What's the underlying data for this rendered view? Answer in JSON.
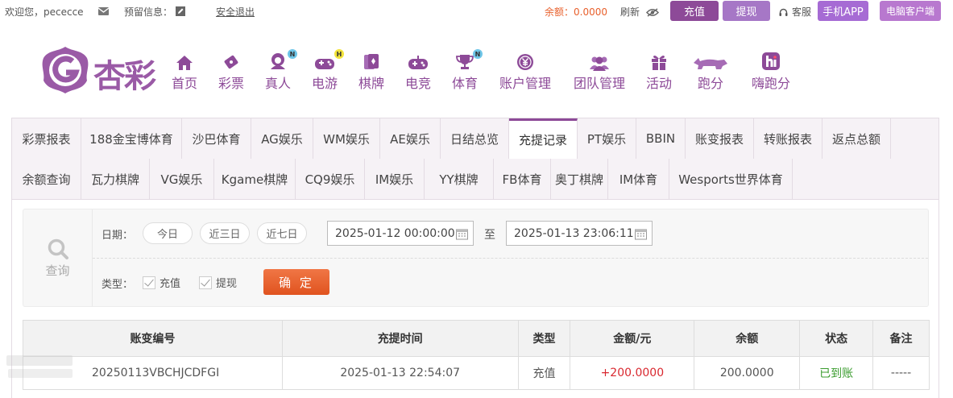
{
  "topbar": {
    "welcome": "欢迎您，pececce",
    "reserved_label": "预留信息：",
    "logout": "安全退出",
    "balance_label": "余额：",
    "balance_value": "0.0000",
    "refresh": "刷新",
    "deposit": "充值",
    "withdraw": "提现",
    "service": "客服",
    "mobile_app": "手机APP",
    "pc_client": "电脑客户端"
  },
  "logo_text": "杏彩",
  "nav": [
    {
      "label": "首页",
      "icon": "home-icon"
    },
    {
      "label": "彩票",
      "icon": "ticket-icon"
    },
    {
      "label": "真人",
      "icon": "live-dealer-icon",
      "badge": "N"
    },
    {
      "label": "电游",
      "icon": "gamepad-icon",
      "badge": "H"
    },
    {
      "label": "棋牌",
      "icon": "cards-icon"
    },
    {
      "label": "电竞",
      "icon": "esports-controller-icon"
    },
    {
      "label": "体育",
      "icon": "trophy-icon",
      "badge": "N"
    },
    {
      "label": "账户管理",
      "icon": "account-coin-icon"
    },
    {
      "label": "团队管理",
      "icon": "team-icon"
    },
    {
      "label": "活动",
      "icon": "gift-icon"
    },
    {
      "label": "跑分",
      "icon": "rhino-icon"
    },
    {
      "label": "嗨跑分",
      "icon": "hi-icon"
    }
  ],
  "tabs_row1": [
    "彩票报表",
    "188金宝博体育",
    "沙巴体育",
    "AG娱乐",
    "WM娱乐",
    "AE娱乐",
    "日结总览",
    "充提记录",
    "PT娱乐",
    "BBIN",
    "账变报表",
    "转账报表",
    "返点总额"
  ],
  "tabs_row2": [
    "余额查询",
    "瓦力棋牌",
    "VG娱乐",
    "Kgame棋牌",
    "CQ9娱乐",
    "IM娱乐",
    "YY棋牌",
    "FB体育",
    "奥丁棋牌",
    "IM体育",
    "Wesports世界体育"
  ],
  "active_tab": "充提记录",
  "query": {
    "icon_label": "查询",
    "date_label": "日期：",
    "quick_ranges": [
      "今日",
      "近三日",
      "近七日"
    ],
    "start": "2025-01-12 00:00:00",
    "to": "至",
    "end": "2025-01-13 23:06:11",
    "type_label": "类型：",
    "types": [
      "充值",
      "提现"
    ],
    "submit": "确 定"
  },
  "table": {
    "headers": [
      "账变编号",
      "充提时间",
      "类型",
      "金额/元",
      "余额",
      "状态",
      "备注"
    ],
    "rows": [
      [
        "20250113VBCHJCDFGI",
        "2025-01-13 22:54:07",
        "充值",
        "+200.0000",
        "200.0000",
        "已到账",
        "-----"
      ]
    ]
  },
  "colors": {
    "brand": "#8d4a98",
    "amount_positive": "#d9282f",
    "status_ok": "#3a9c2e",
    "confirm": "#e8602c",
    "balance": "#e8602c"
  }
}
